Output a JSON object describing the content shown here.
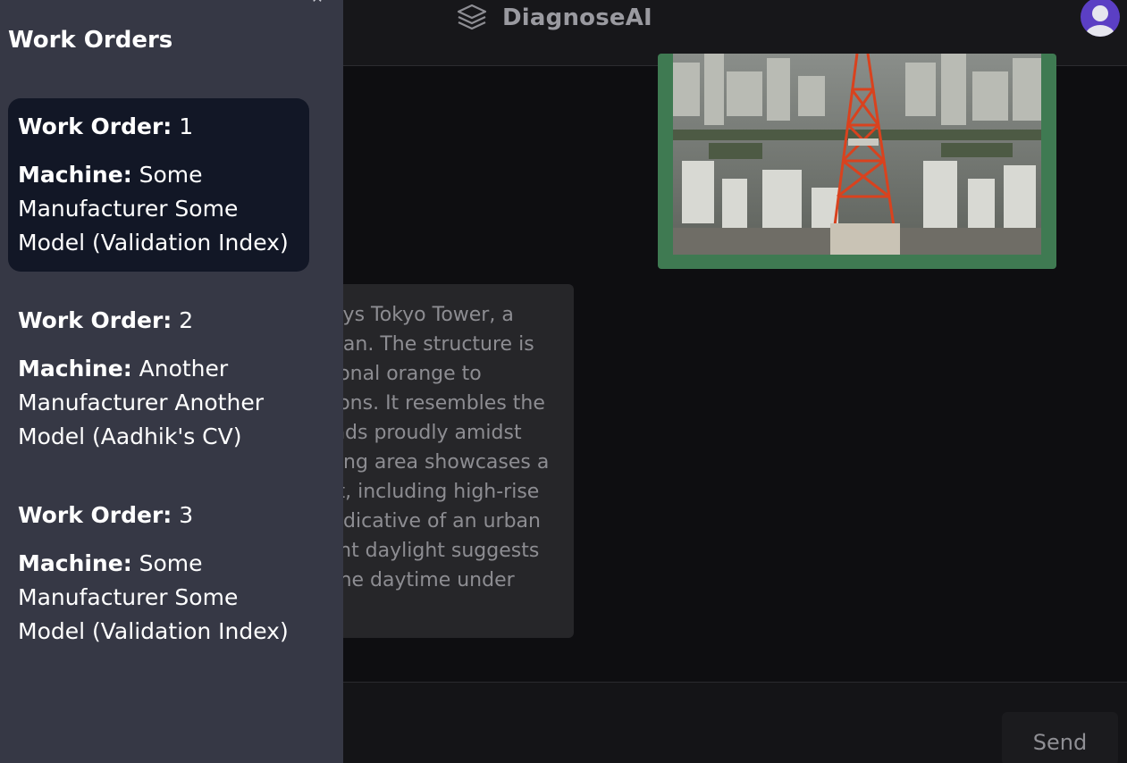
{
  "header": {
    "app_title": "DiagnoseAI",
    "logo_icon": "layers-icon",
    "avatar_icon": "user-avatar-icon",
    "avatar_color": "#5b3fc4"
  },
  "sidebar": {
    "title": "Work Orders",
    "close_icon": "close-icon",
    "work_order_label": "Work Order:",
    "machine_label": "Machine:",
    "items": [
      {
        "number": "1",
        "machine_line1": "Some",
        "machine_line2": "Manufacturer Some",
        "machine_line3": "Model (Validation Index)",
        "selected": true
      },
      {
        "number": "2",
        "machine_line1": "Another",
        "machine_line2": "Manufacturer Another",
        "machine_line3": "Model (Aadhik's CV)",
        "selected": false
      },
      {
        "number": "3",
        "machine_line1": "Some",
        "machine_line2": "Manufacturer Some",
        "machine_line3": "Model (Validation Index)",
        "selected": false
      }
    ]
  },
  "chat": {
    "response_text": "plays Tokyo Tower, a\nJapan. The structure is\national orange to\nations. It resembles the\ntands proudly amidst\nnding area showcases a\nent, including high-rise\n, indicative of an urban\nright daylight suggests\ng the daytime under",
    "image_alt": "Tokyo Tower photo"
  },
  "composer": {
    "send_label": "Send"
  },
  "colors": {
    "sidebar_bg": "#363845",
    "selected_card_bg": "#121726",
    "image_frame": "#3f7a52",
    "bubble_bg": "#262629"
  }
}
